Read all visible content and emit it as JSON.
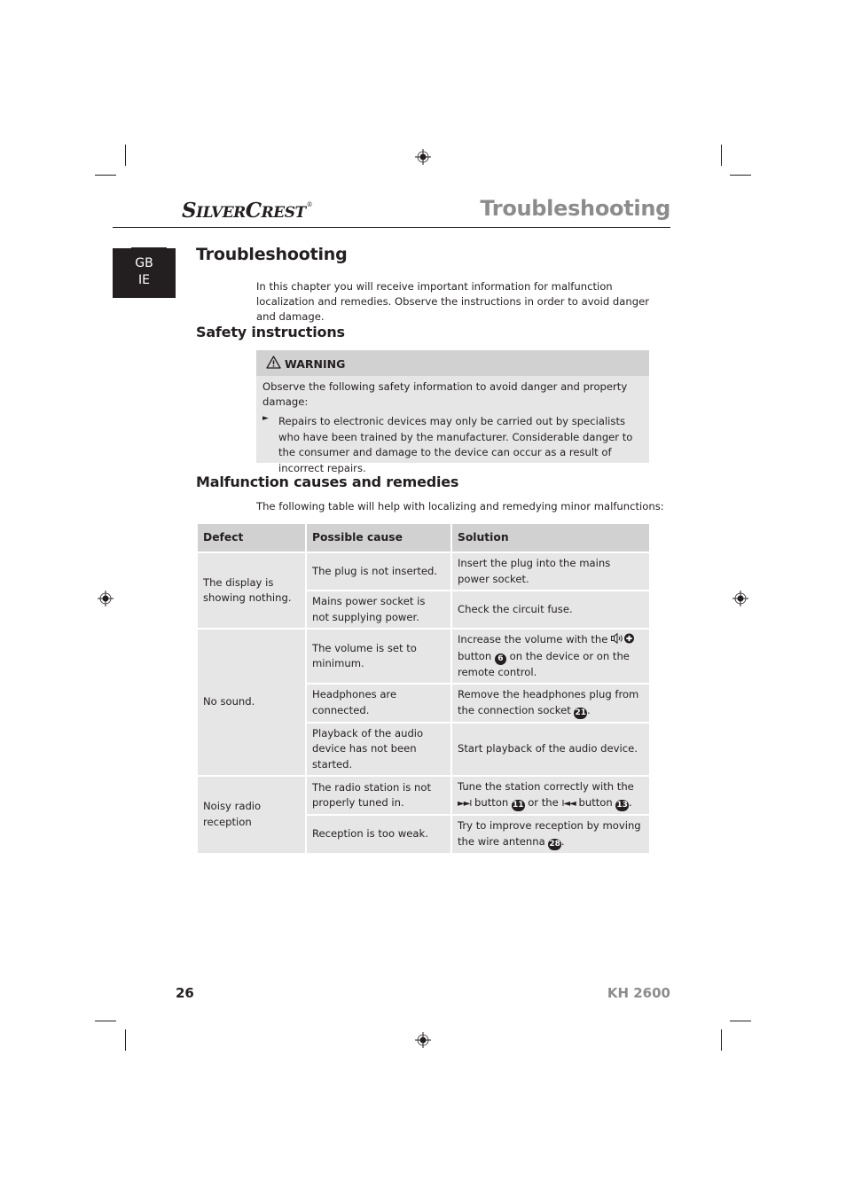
{
  "header": {
    "brand_big_1": "S",
    "brand_small_1": "ILVER",
    "brand_big_2": "C",
    "brand_small_2": "REST",
    "brand_mark": "®",
    "section_title": "Troubleshooting"
  },
  "language_tab": {
    "line1": "GB",
    "line2": "IE"
  },
  "main": {
    "title": "Troubleshooting",
    "intro": "In this chapter you will receive important information for malfunction localization and remedies. Observe the instructions in order to avoid danger and damage."
  },
  "safety": {
    "heading": "Safety instructions",
    "warning_icon": "warning-triangle-icon",
    "warning_label": "WARNING",
    "warning_text": "Observe the following safety information to avoid danger and property damage:",
    "bullet_icon": "arrow-bullet-icon",
    "bullet_text": "Repairs to electronic devices may only be carried out by specialists who have been trained by the manufacturer. Considerable danger to the consumer and damage to the device can occur as a result of incorrect repairs."
  },
  "malfunctions": {
    "heading": "Malfunction causes and remedies",
    "intro": "The following table will help with localizing and remedying minor malfunctions:",
    "columns": [
      "Defect",
      "Possible cause",
      "Solution"
    ],
    "rows": [
      {
        "defect": "The display is showing nothing.",
        "causes": [
          {
            "cause": "The plug is not inserted.",
            "solution": "Insert the plug into the mains power socket."
          },
          {
            "cause": "Mains power socket is not supplying power.",
            "solution": "Check the circuit fuse."
          }
        ]
      },
      {
        "defect": "No sound.",
        "causes": [
          {
            "cause": "The volume is set to minimum.",
            "solution_parts": {
              "a": "Increase the volume with the",
              "sym": "🔊✚",
              "b": "button",
              "n1": "6",
              "c": "on the device or on the remote control."
            }
          },
          {
            "cause": "Headphones are connected.",
            "solution_parts": {
              "a": "Remove the headphones plug from the connection socket",
              "n1": "21",
              "b": "."
            }
          },
          {
            "cause": "Playback of the audio device has not been started.",
            "solution": "Start playback of the audio device."
          }
        ]
      },
      {
        "defect": "Noisy radio reception",
        "causes": [
          {
            "cause": "The radio station is not properly tuned in.",
            "solution_parts": {
              "a": "Tune the station correctly with the",
              "sym1": "►►I",
              "b": "button",
              "n1": "11",
              "c": "or the",
              "sym2": "I◄◄",
              "d": "button",
              "n2": "13",
              "e": "."
            }
          },
          {
            "cause": "Reception is too weak.",
            "solution_parts": {
              "a": "Try to improve reception by moving the wire antenna",
              "n1": "28",
              "b": "."
            }
          }
        ]
      }
    ]
  },
  "footer": {
    "page_number": "26",
    "model": "KH 2600"
  }
}
